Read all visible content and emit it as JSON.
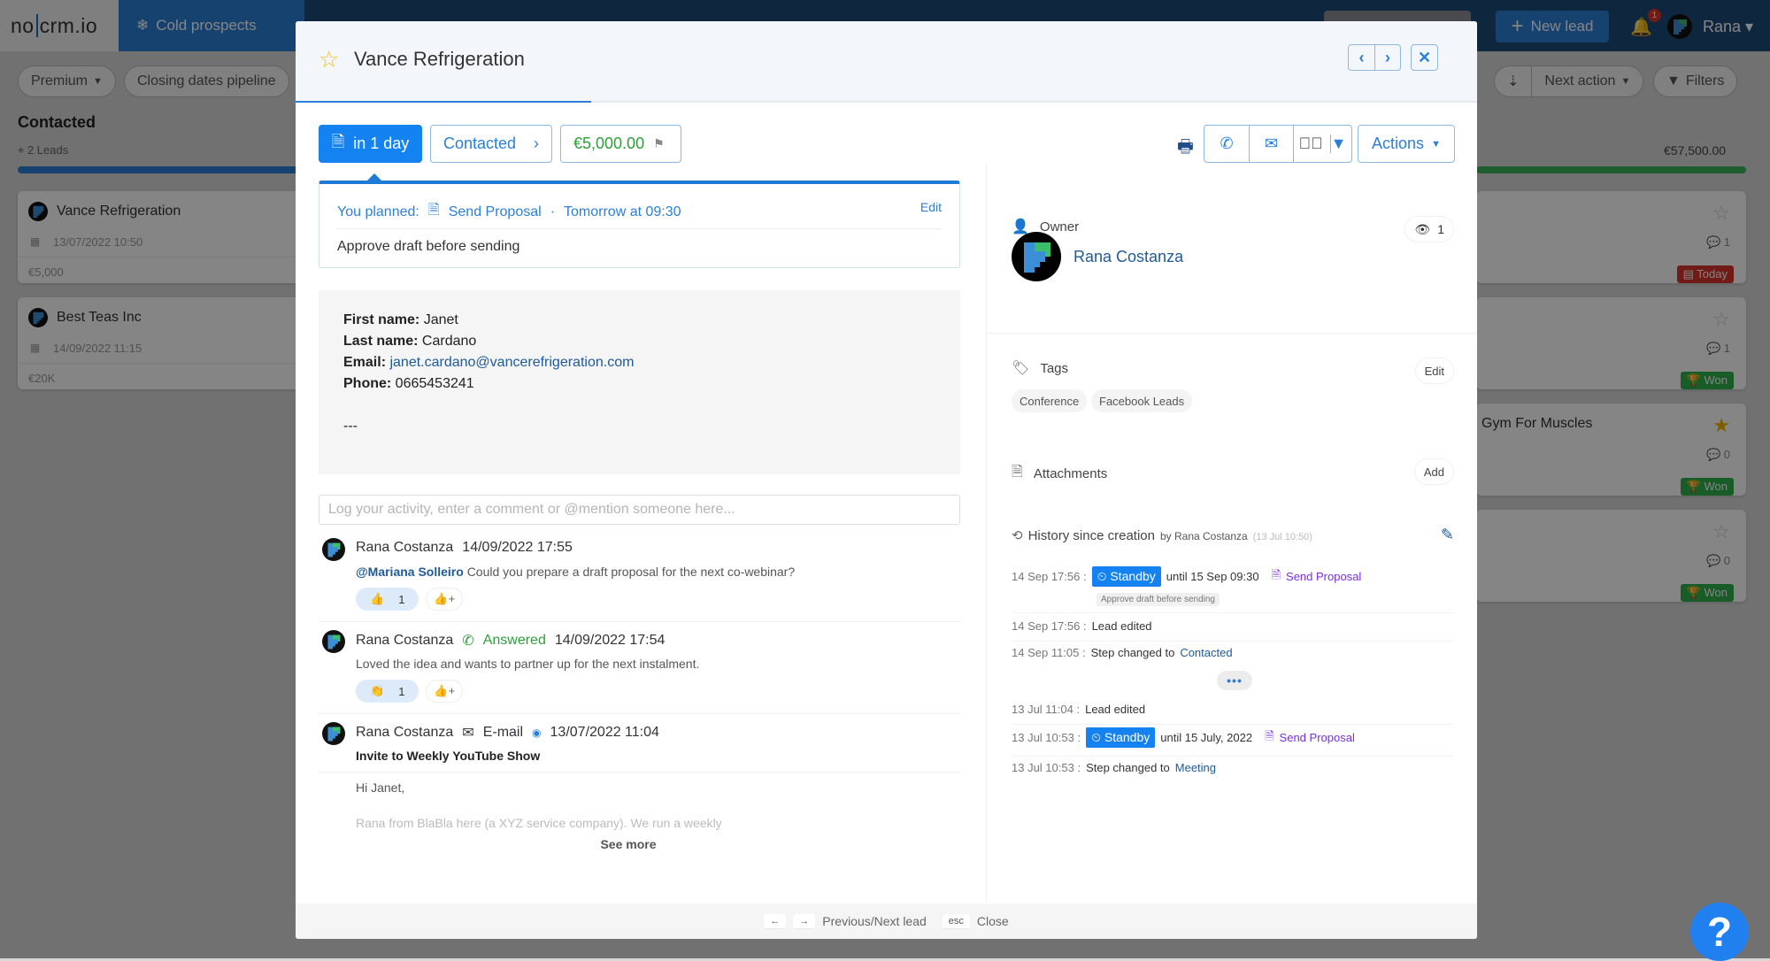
{
  "app": {
    "logo": {
      "left": "no",
      "right": "crm.io"
    },
    "pipeline_tab": "Cold prospects",
    "new_lead_label": "New lead",
    "notification_count": "1",
    "user_name": "Rana"
  },
  "filters": {
    "view": "Premium",
    "pipeline": "Closing dates pipeline",
    "sort": "Next action",
    "filters_label": "Filters"
  },
  "column_left": {
    "title": "Contacted",
    "count": "2 Leads",
    "cards": [
      {
        "name": "Vance Refrigeration",
        "date": "13/07/2022 10:50",
        "amount": "€5,000"
      },
      {
        "name": "Best Teas Inc",
        "date": "14/09/2022 11:15",
        "amount": "€20K"
      }
    ]
  },
  "column_right": {
    "amount": "€57,500.00",
    "cards": [
      {
        "name": "",
        "starred": false,
        "comments": "1",
        "badge": "Today",
        "badge_type": "today"
      },
      {
        "name": "",
        "starred": false,
        "comments": "1",
        "badge": "Won",
        "badge_type": "won"
      },
      {
        "name": "Gym For Muscles",
        "starred": true,
        "comments": "0",
        "badge": "Won",
        "badge_type": "won"
      },
      {
        "name": "",
        "starred": false,
        "comments": "0",
        "badge": "Won",
        "badge_type": "won"
      }
    ]
  },
  "lead": {
    "title": "Vance Refrigeration",
    "next_action_label": "in 1 day",
    "step_label": "Contacted",
    "amount": "€5,000.00",
    "actions_label": "Actions",
    "planned": {
      "prefix": "You planned:",
      "action": "Send Proposal",
      "separator": "·",
      "when": "Tomorrow at 09:30",
      "edit": "Edit",
      "note": "Approve draft before sending"
    },
    "description": {
      "first_name_label": "First name:",
      "first_name": "Janet",
      "last_name_label": "Last name:",
      "last_name": "Cardano",
      "email_label": "Email:",
      "email": "janet.cardano@vancerefrigeration.com",
      "phone_label": "Phone:",
      "phone": "0665453241",
      "trailer": "---"
    },
    "comment_placeholder": "Log your activity, enter a comment or @mention someone here...",
    "activities": [
      {
        "author": "Rana Costanza",
        "datetime": "14/09/2022 17:55",
        "mention": "@Mariana Solleiro",
        "text": "Could you prepare a draft proposal for the next co-webinar?",
        "reaction_emoji": "👍",
        "reaction_count": "1"
      },
      {
        "author": "Rana Costanza",
        "type": "Answered",
        "datetime": "14/09/2022 17:54",
        "text": "Loved the idea and wants to partner up for the next instalment.",
        "reaction_emoji": "👏",
        "reaction_count": "1"
      },
      {
        "author": "Rana Costanza",
        "type": "E-mail",
        "datetime": "13/07/2022 11:04",
        "subject": "Invite to Weekly YouTube Show",
        "greeting": "Hi Janet,",
        "preview": "Rana from BlaBla here (a XYZ service company). We run a weekly"
      }
    ],
    "see_more": "See more",
    "owner": {
      "label": "Owner",
      "name": "Rana Costanza",
      "viewers": "1"
    },
    "tags": {
      "label": "Tags",
      "edit": "Edit",
      "items": [
        "Conference",
        "Facebook Leads"
      ]
    },
    "attachments": {
      "label": "Attachments",
      "add": "Add"
    },
    "history": {
      "title": "History since creation",
      "by": "by Rana Costanza",
      "created": "(13 Jul 10:50)",
      "entries": [
        {
          "time": "14 Sep 17:56 :",
          "standby": "Standby",
          "until": "until 15 Sep 09:30",
          "action": "Send Proposal",
          "note": "Approve draft before sending"
        },
        {
          "time": "14 Sep 17:56 :",
          "text": "Lead edited"
        },
        {
          "time": "14 Sep 11:05 :",
          "text": "Step changed to",
          "link": "Contacted"
        },
        {
          "time": "13 Jul 11:04 :",
          "text": "Lead edited"
        },
        {
          "time": "13 Jul 10:53 :",
          "standby": "Standby",
          "until": "until 15 July, 2022",
          "action": "Send Proposal"
        },
        {
          "time": "13 Jul 10:53 :",
          "text": "Step changed to",
          "link": "Meeting"
        }
      ],
      "more": "•••"
    },
    "footer": {
      "prev_key": "←",
      "next_key": "→",
      "nav_label": "Previous/Next lead",
      "esc_key": "esc",
      "close_label": "Close"
    }
  },
  "colors": {
    "primary": "#1482f0",
    "won": "#2fb14c",
    "today": "#d9342b",
    "action_purple": "#7a2ee0",
    "amount_green": "#2e9e3a"
  }
}
